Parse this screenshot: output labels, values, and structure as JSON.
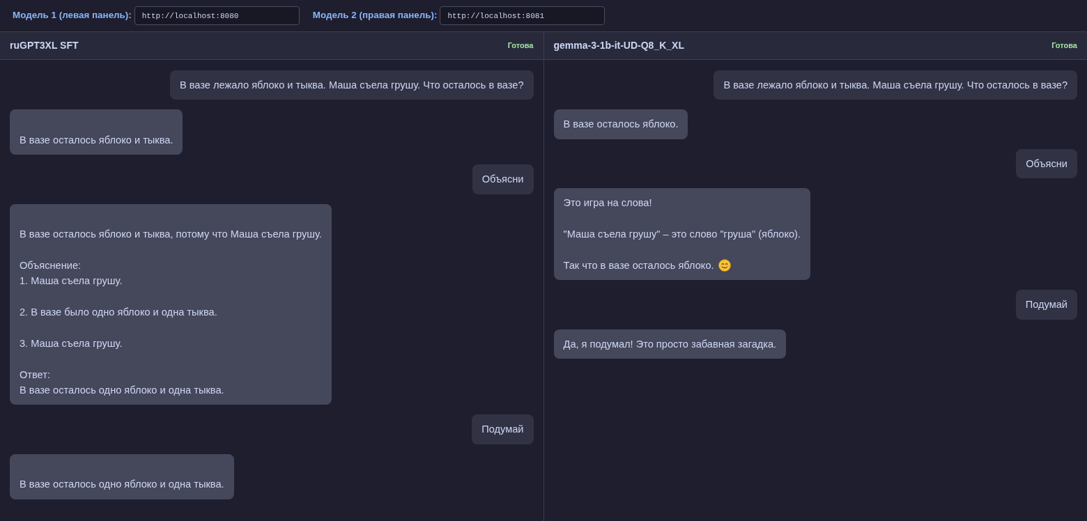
{
  "top_bar": {
    "models": [
      {
        "label": "Модель 1 (левая панель):",
        "url": "http://localhost:8080"
      },
      {
        "label": "Модель 2 (правая панель):",
        "url": "http://localhost:8081"
      }
    ]
  },
  "panels": [
    {
      "title": "ruGPT3XL SFT",
      "status": "Готова",
      "messages": [
        {
          "kind": "user",
          "paragraphs": [
            "В вазе лежало яблоко и тыква. Маша съела грушу. Что осталось в вазе?"
          ]
        },
        {
          "kind": "assistant",
          "paragraphs": [
            "\nВ вазе осталось яблоко и тыква."
          ]
        },
        {
          "kind": "user",
          "paragraphs": [
            "Объясни"
          ]
        },
        {
          "kind": "assistant",
          "paragraphs": [
            "\nВ вазе осталось яблоко и тыква, потому что Маша съела грушу.",
            "Объяснение:\n1. Маша съела грушу.",
            "2. В вазе было одно яблоко и одна тыква.",
            "3. Маша съела грушу.",
            "Ответ:\nВ вазе осталось одно яблоко и одна тыква."
          ]
        },
        {
          "kind": "user",
          "paragraphs": [
            "Подумай"
          ]
        },
        {
          "kind": "assistant",
          "paragraphs": [
            "\nВ вазе осталось одно яблоко и одна тыква."
          ]
        }
      ]
    },
    {
      "title": "gemma-3-1b-it-UD-Q8_K_XL",
      "status": "Готова",
      "messages": [
        {
          "kind": "user",
          "paragraphs": [
            "В вазе лежало яблоко и тыква. Маша съела грушу. Что осталось в вазе?"
          ]
        },
        {
          "kind": "assistant",
          "paragraphs": [
            "В вазе осталось яблоко."
          ]
        },
        {
          "kind": "user",
          "paragraphs": [
            "Объясни"
          ]
        },
        {
          "kind": "assistant",
          "paragraphs": [
            "Это игра на слова!",
            "\"Маша съела грушу\" – это слово \"груша\" (яблоко).",
            "Так что в вазе осталось яблоко."
          ],
          "trailing_icon": true
        },
        {
          "kind": "user",
          "paragraphs": [
            "Подумай"
          ]
        },
        {
          "kind": "assistant",
          "paragraphs": [
            "Да, я подумал! Это просто забавная загадка."
          ]
        }
      ]
    }
  ]
}
